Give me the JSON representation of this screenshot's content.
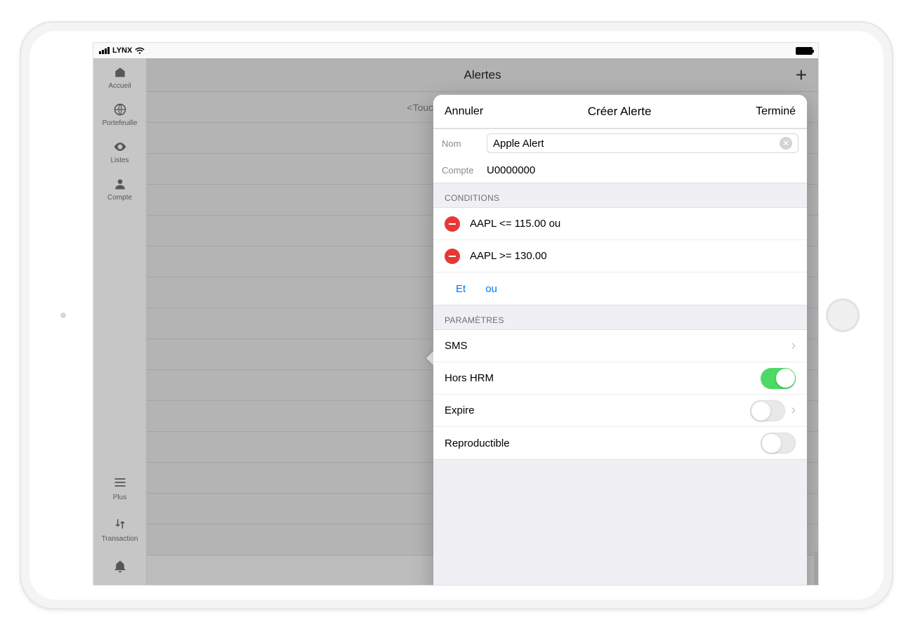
{
  "status_bar": {
    "carrier": "LYNX"
  },
  "sidebar": {
    "items": [
      {
        "label": "Accueil"
      },
      {
        "label": "Portefeuille"
      },
      {
        "label": "Listes"
      },
      {
        "label": "Compte"
      }
    ],
    "plus_label": "Plus",
    "transaction_label": "Transaction"
  },
  "main": {
    "title": "Alertes",
    "placeholder": "<Touchez + pour créer une Alerte>"
  },
  "modal": {
    "cancel": "Annuler",
    "title": "Créer Alerte",
    "done": "Terminé",
    "name_label": "Nom",
    "name_value": "Apple Alert",
    "account_label": "Compte",
    "account_value": "U0000000",
    "conditions_header": "CONDITIONS",
    "conditions": [
      {
        "text": "AAPL <= 115.00 ou"
      },
      {
        "text": "AAPL >= 130.00"
      }
    ],
    "logic_and": "Et",
    "logic_or": "ou",
    "settings_header": "PARAMÈTRES",
    "settings": {
      "sms_label": "SMS",
      "hors_hrm_label": "Hors HRM",
      "hors_hrm_on": true,
      "expire_label": "Expire",
      "expire_on": false,
      "repeat_label": "Reproductible",
      "repeat_on": false
    }
  }
}
